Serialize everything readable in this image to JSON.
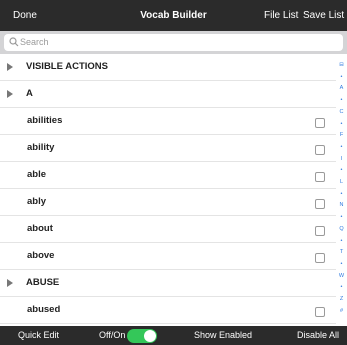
{
  "topbar": {
    "done_label": "Done",
    "title": "Vocab Builder",
    "file_list_label": "File List",
    "save_list_label": "Save List"
  },
  "search": {
    "placeholder": "Search"
  },
  "list": [
    {
      "label": "VISIBLE ACTIONS",
      "type": "section"
    },
    {
      "label": "A",
      "type": "section"
    },
    {
      "label": "abilities",
      "type": "word"
    },
    {
      "label": "ability",
      "type": "word"
    },
    {
      "label": "able",
      "type": "word"
    },
    {
      "label": "ably",
      "type": "word"
    },
    {
      "label": "about",
      "type": "word"
    },
    {
      "label": "above",
      "type": "word"
    },
    {
      "label": "ABUSE",
      "type": "section"
    },
    {
      "label": "abused",
      "type": "word"
    }
  ],
  "index_letters": [
    "⊟",
    "•",
    "A",
    "•",
    "C",
    "•",
    "F",
    "•",
    "I",
    "•",
    "L",
    "•",
    "N",
    "•",
    "Q",
    "•",
    "T",
    "•",
    "W",
    "•",
    "Z",
    "#"
  ],
  "bottombar": {
    "quick_edit_label": "Quick Edit",
    "toggle_label": "Off/On",
    "toggle_on": true,
    "show_enabled_label": "Show Enabled",
    "disable_all_label": "Disable All"
  },
  "colors": {
    "bar_bg": "#2b2b2b",
    "toggle_on": "#34c759",
    "index_blue": "#2f7be0"
  }
}
